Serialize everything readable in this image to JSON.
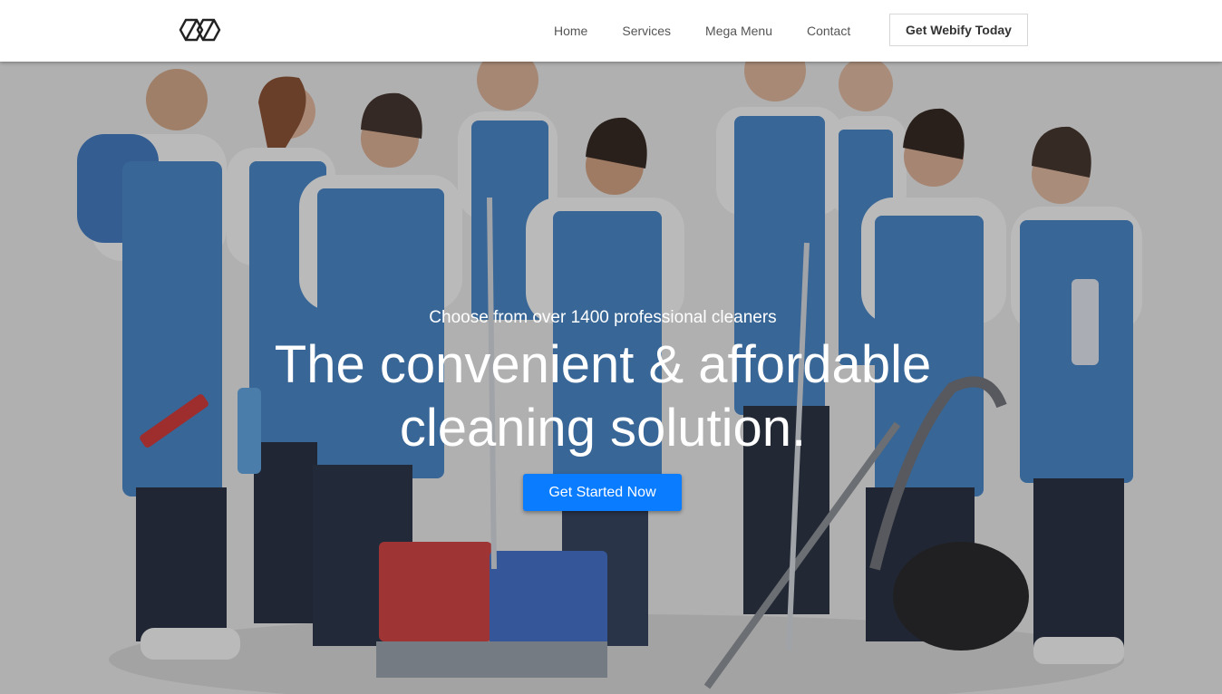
{
  "brand": {
    "logo_icon": "geometric-logo-icon"
  },
  "nav": {
    "items": [
      {
        "label": "Home"
      },
      {
        "label": "Services"
      },
      {
        "label": "Mega Menu"
      },
      {
        "label": "Contact"
      }
    ],
    "cta_label": "Get Webify Today"
  },
  "hero": {
    "subtitle": "Choose from over 1400 professional cleaners",
    "title": "The convenient & affordable cleaning solution.",
    "button_label": "Get Started Now",
    "background_image": "team-of-cleaners-photo",
    "accent_color": "#0a7cff"
  }
}
